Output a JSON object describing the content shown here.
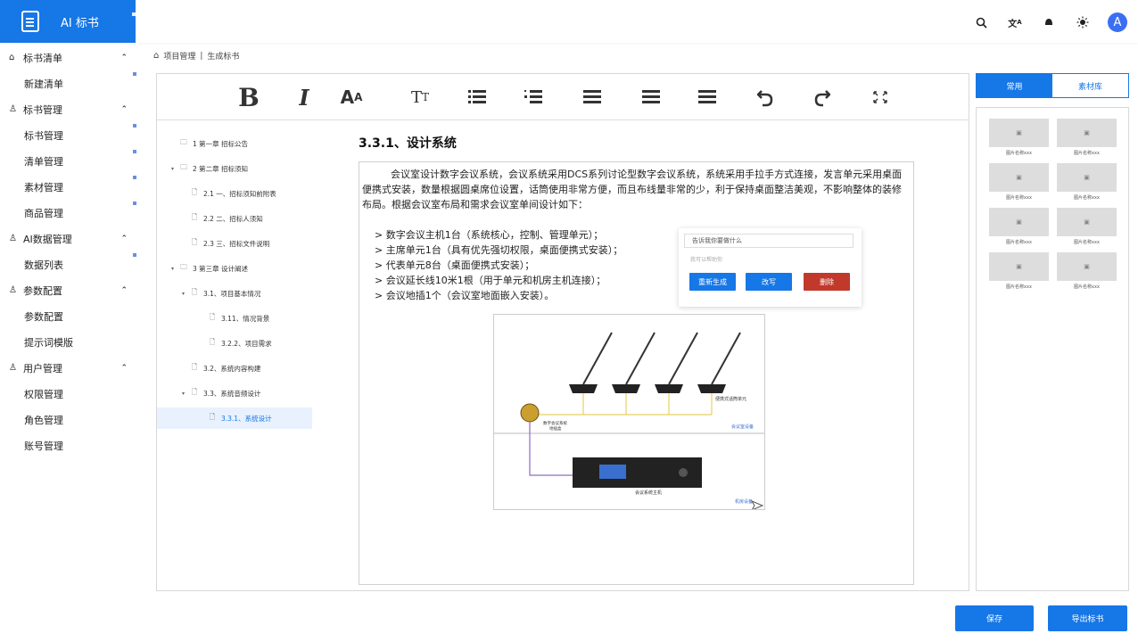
{
  "app": {
    "title": "AI 标书"
  },
  "topbar": {
    "icons": [
      "search-icon",
      "translate-icon",
      "notification-icon",
      "theme-icon"
    ],
    "avatar_letter": "A"
  },
  "sidebar": {
    "groups": [
      {
        "label": "标书清单",
        "icon": "home-icon",
        "items": [
          "新建清单"
        ]
      },
      {
        "label": "标书管理",
        "icon": "user-icon",
        "items": [
          "标书管理",
          "清单管理",
          "素材管理",
          "商品管理"
        ]
      },
      {
        "label": "AI数据管理",
        "icon": "user-icon",
        "items": [
          "数据列表"
        ]
      },
      {
        "label": "参数配置",
        "icon": "user-icon",
        "items": [
          "参数配置",
          "提示词模版"
        ]
      },
      {
        "label": "用户管理",
        "icon": "user-icon",
        "items": [
          "权限管理",
          "角色管理",
          "账号管理"
        ]
      }
    ]
  },
  "breadcrumb": {
    "items": [
      "项目管理",
      "生成标书"
    ],
    "separator": "|"
  },
  "toolbar": {
    "tools": [
      "bold",
      "italic",
      "font",
      "text-size",
      "list",
      "indent-list",
      "align-left",
      "align-center",
      "align-right",
      "undo",
      "redo",
      "fullscreen"
    ]
  },
  "tree": [
    {
      "label": "1 第一章 招标公告",
      "level": 0,
      "arrow": "",
      "icon": "folder"
    },
    {
      "label": "2 第二章 招标须知",
      "level": 0,
      "arrow": "▾",
      "icon": "folder"
    },
    {
      "label": "2.1 一、招标须知前附表",
      "level": 1,
      "arrow": "",
      "icon": "file"
    },
    {
      "label": "2.2 二、招标人须知",
      "level": 1,
      "arrow": "",
      "icon": "file"
    },
    {
      "label": "2.3 三、招标文件说明",
      "level": 1,
      "arrow": "",
      "icon": "file"
    },
    {
      "label": "3 第三章 设计阐述",
      "level": 0,
      "arrow": "▾",
      "icon": "folder"
    },
    {
      "label": "3.1、项目基本情况",
      "level": 1,
      "arrow": "▾",
      "icon": "file"
    },
    {
      "label": "3.11、情况背景",
      "level": 2,
      "arrow": "",
      "icon": "file"
    },
    {
      "label": "3.2.2、项目需求",
      "level": 2,
      "arrow": "",
      "icon": "file"
    },
    {
      "label": "3.2、系统内容构建",
      "level": 1,
      "arrow": "",
      "icon": "file"
    },
    {
      "label": "3.3、系统音频设计",
      "level": 1,
      "arrow": "▾",
      "icon": "file"
    },
    {
      "label": "3.3.1、系统设计",
      "level": 2,
      "arrow": "",
      "icon": "file",
      "selected": true
    }
  ],
  "document": {
    "heading": "3.3.1、设计系统",
    "paragraph": "会议室设计数字会议系统，会议系统采用DCS系列讨论型数字会议系统，系统采用手拉手方式连接，发言单元采用桌面便携式安装，数量根据圆桌席位设置，话筒使用非常方便，而且布线量非常的少，利于保持桌面整洁美观，不影响整体的装修布局。根据会议室布局和需求会议室单间设计如下：",
    "bullets": [
      "> 数字会议主机1台（系统核心，控制、管理单元）；",
      "> 主席单元1台（具有优先强切权限，桌面便携式安装）；",
      "> 代表单元8台（桌面便携式安装）；",
      "> 会议延长线10米1根（用于单元和机房主机连接）；",
      "> 会议地插1个（会议室地面嵌入安装）。"
    ],
    "diagram_labels": {
      "unit": "便携式话筒单元",
      "floor_box": "数字会议系统\n地插盒",
      "meeting_room": "会议室设备",
      "host": "会议系统主机",
      "server_room": "机房设备"
    }
  },
  "ai_popup": {
    "input_placeholder": "告诉我你要做什么",
    "hint": "我可以帮助你",
    "buttons": [
      {
        "label": "重新生成",
        "color": "#1677e6"
      },
      {
        "label": "改写",
        "color": "#1677e6"
      },
      {
        "label": "删除",
        "color": "#c0392b"
      }
    ]
  },
  "right_panel": {
    "tabs": [
      "常用",
      "素材库"
    ],
    "active_tab": "常用",
    "thumb_caption": "图片名称xxx",
    "thumb_count": 8
  },
  "actions": {
    "save": "保存",
    "export": "导出标书"
  },
  "colors": {
    "primary": "#1677e6",
    "danger": "#c0392b",
    "selected_bg": "#e8f1fd"
  }
}
